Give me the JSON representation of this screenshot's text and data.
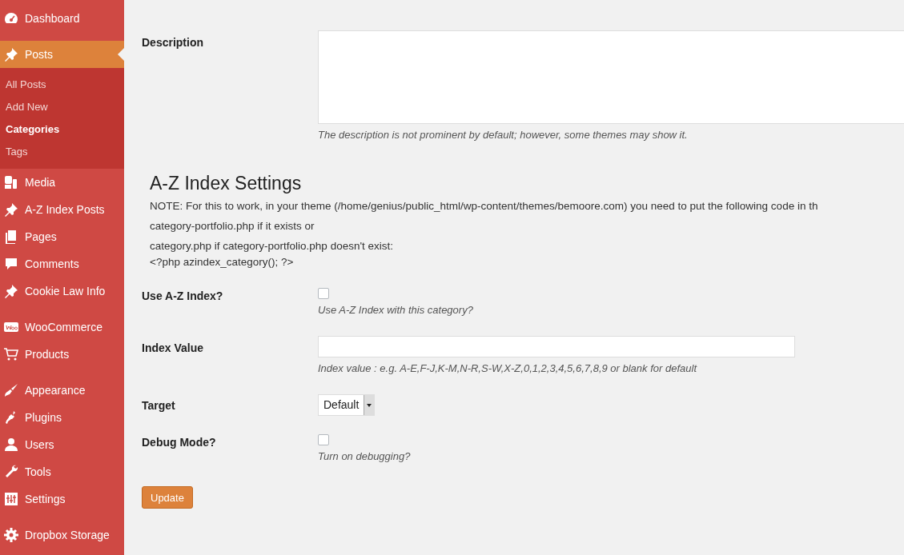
{
  "sidebar": {
    "items": [
      {
        "label": "Dashboard",
        "selected": false,
        "separator_before": false
      },
      {
        "label": "Posts",
        "selected": true,
        "separator_before": true,
        "children": [
          {
            "label": "All Posts",
            "selected": false
          },
          {
            "label": "Add New",
            "selected": false
          },
          {
            "label": "Categories",
            "selected": true
          },
          {
            "label": "Tags",
            "selected": false
          }
        ]
      },
      {
        "label": "Media",
        "selected": false,
        "separator_before": false
      },
      {
        "label": "A-Z Index Posts",
        "selected": false,
        "separator_before": false
      },
      {
        "label": "Pages",
        "selected": false,
        "separator_before": false
      },
      {
        "label": "Comments",
        "selected": false,
        "separator_before": false
      },
      {
        "label": "Cookie Law Info",
        "selected": false,
        "separator_before": false
      },
      {
        "label": "WooCommerce",
        "selected": false,
        "separator_before": true
      },
      {
        "label": "Products",
        "selected": false,
        "separator_before": false
      },
      {
        "label": "Appearance",
        "selected": false,
        "separator_before": true
      },
      {
        "label": "Plugins",
        "selected": false,
        "separator_before": false
      },
      {
        "label": "Users",
        "selected": false,
        "separator_before": false
      },
      {
        "label": "Tools",
        "selected": false,
        "separator_before": false
      },
      {
        "label": "Settings",
        "selected": false,
        "separator_before": false
      },
      {
        "label": "Dropbox Storage",
        "selected": false,
        "separator_before": true
      }
    ]
  },
  "description": {
    "label": "Description",
    "help": "The description is not prominent by default; however, some themes may show it."
  },
  "az_settings": {
    "title": "A-Z Index Settings",
    "note_lines": [
      "NOTE: For this to work, in your theme (/home/genius/public_html/wp-content/themes/bemoore.com) you need to put the following code in th",
      "category-portfolio.php if it exists or",
      "category.php if category-portfolio.php doesn't exist:",
      "<?php azindex_category(); ?>"
    ],
    "fields": [
      {
        "kind": "checkbox",
        "label": "Use A-Z Index?",
        "checked": false,
        "help": "Use A-Z Index with this category?"
      },
      {
        "kind": "text",
        "label": "Index Value",
        "help": "Index value : e.g. A-E,F-J,K-M,N-R,S-W,X-Z,0,1,2,3,4,5,6,7,8,9 or blank for default"
      },
      {
        "kind": "select",
        "label": "Target",
        "value": "Default"
      },
      {
        "kind": "checkbox",
        "label": "Debug Mode?",
        "checked": false,
        "help": "Turn on debugging?"
      }
    ]
  },
  "update_button": "Update"
}
